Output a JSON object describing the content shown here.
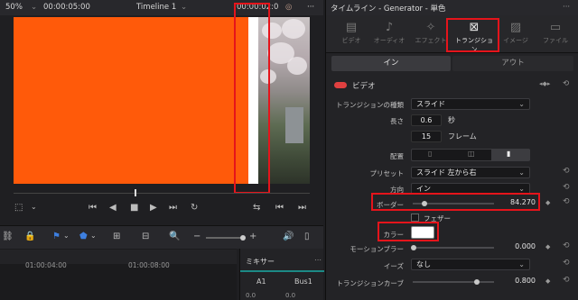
{
  "viewer": {
    "zoom": "50%",
    "timecode": "00:00:05:00",
    "timeline_name": "Timeline 1",
    "timecode_right": "00:00:02:0",
    "ruler": {
      "t1": "01:00:04:00",
      "t2": "01:00:08:00"
    },
    "mixer": {
      "title": "ミキサー",
      "ch1": "A1",
      "ch2": "Bus1",
      "val1": "0.0",
      "val2": "0.0"
    }
  },
  "inspector": {
    "title": "タイムライン - Generator - 単色",
    "tabs": [
      {
        "label": "ビデオ",
        "icon": "video-icon"
      },
      {
        "label": "オーディオ",
        "icon": "audio-icon"
      },
      {
        "label": "エフェクト",
        "icon": "effects-icon"
      },
      {
        "label": "トランジション",
        "icon": "transition-icon"
      },
      {
        "label": "イメージ",
        "icon": "image-icon"
      },
      {
        "label": "ファイル",
        "icon": "file-icon"
      }
    ],
    "in_label": "イン",
    "out_label": "アウト",
    "section_title": "ビデオ",
    "fields": {
      "transition_type_label": "トランジションの種類",
      "transition_type_value": "スライド",
      "length_label": "長さ",
      "length_seconds": "0.6",
      "seconds_unit": "秒",
      "length_frames": "15",
      "frames_unit": "フレーム",
      "alignment_label": "配置",
      "preset_label": "プリセット",
      "preset_value": "スライド 左から右",
      "direction_label": "方向",
      "direction_value": "イン",
      "border_label": "ボーダー",
      "border_value": "84.270",
      "feather_label": "フェザー",
      "color_label": "カラー",
      "color_value": "#ffffff",
      "motion_blur_label": "モーションブラー",
      "motion_blur_value": "0.000",
      "ease_label": "イーズ",
      "ease_value": "なし",
      "transition_curve_label": "トランジションカーブ",
      "transition_curve_value": "0.800"
    }
  },
  "colors": {
    "accent_red": "#e5141b",
    "preview_orange": "#ff5a0a"
  }
}
